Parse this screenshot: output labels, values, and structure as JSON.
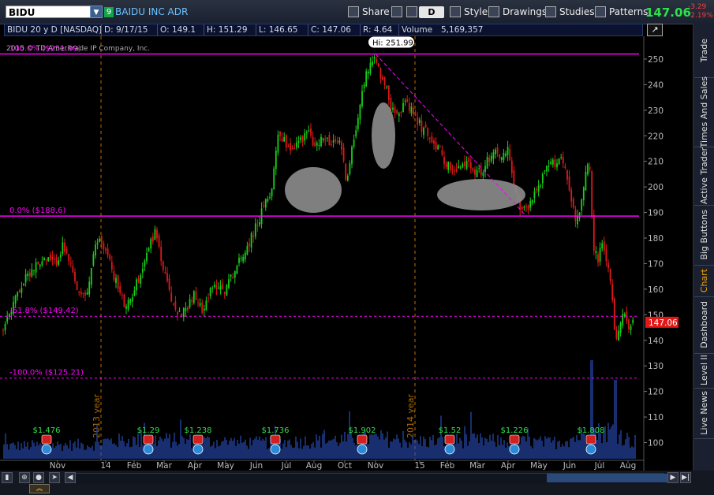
{
  "toolbar": {
    "symbol": "BIDU",
    "link_number": "9",
    "company": "BAIDU INC ADR",
    "share_label": "Share",
    "aggregation": "D",
    "style_label": "Style",
    "drawings_label": "Drawings",
    "studies_label": "Studies",
    "patterns_label": "Patterns",
    "last_price": "147.06",
    "net_change": "-3.29",
    "pct_change": "-2.19%"
  },
  "infobar": {
    "study": "BIDU 20 y D [NASDAQ]",
    "date": "D: 9/17/15",
    "open": "O: 149.1",
    "high": "H: 151.29",
    "low": "L: 146.65",
    "close": "C: 147.06",
    "range": "R: 4.64",
    "volume": "Volume",
    "volume_value": "5,169,357"
  },
  "copyright": "2015 © TD Ameritrade IP Company, Inc.",
  "right_tabs": [
    "Trade",
    "Times And Sales",
    "Active Trader",
    "Big Buttons",
    "Chart",
    "Dashboard",
    "Level II",
    "Live News"
  ],
  "colors": {
    "up": "#19d019",
    "down": "#e01818",
    "fib": "#ff00ff",
    "axis_text": "#bbbbbb",
    "price_badge": "#e01818"
  },
  "chart_data": {
    "type": "candlestick",
    "y_ticks": [
      250,
      240,
      230,
      220,
      210,
      200,
      190,
      180,
      170,
      160,
      150,
      140,
      130,
      120,
      110,
      100
    ],
    "y_range": [
      96,
      257
    ],
    "x_labels": [
      "Nov",
      "14",
      "Feb",
      "Mar",
      "Apr",
      "May",
      "Jun",
      "Jul",
      "Aug",
      "Oct",
      "Nov",
      "15",
      "Feb",
      "Mar",
      "Apr",
      "May",
      "Jun",
      "Jul",
      "Aug"
    ],
    "year_markers": [
      "2013 year",
      "2014 year"
    ],
    "hi_label": "Hi: 251.99",
    "current_price_label": "147.06",
    "fib_levels": [
      {
        "label": "100.0%  ($251.99)",
        "price": 251.99,
        "style": "solid"
      },
      {
        "label": "0.0%  ($188.6)",
        "price": 188.6,
        "style": "solid"
      },
      {
        "label": "-61.8%  ($149.42)",
        "price": 149.42,
        "style": "dashed"
      },
      {
        "label": "-100.0%  ($125.21)",
        "price": 125.21,
        "style": "dashed"
      }
    ],
    "dividends": [
      "$1.476",
      "$1.29",
      "$1.238",
      "$1.736",
      "$1.902",
      "$1.52",
      "$1.226",
      "$1.808"
    ],
    "path": [
      [
        0,
        143
      ],
      [
        10,
        150
      ],
      [
        25,
        160
      ],
      [
        40,
        168
      ],
      [
        55,
        172
      ],
      [
        70,
        170
      ],
      [
        80,
        177
      ],
      [
        90,
        168
      ],
      [
        100,
        157
      ],
      [
        110,
        158
      ],
      [
        120,
        175
      ],
      [
        125,
        180
      ],
      [
        130,
        178
      ],
      [
        140,
        170
      ],
      [
        150,
        160
      ],
      [
        160,
        152
      ],
      [
        170,
        160
      ],
      [
        180,
        168
      ],
      [
        190,
        178
      ],
      [
        198,
        183
      ],
      [
        205,
        170
      ],
      [
        215,
        158
      ],
      [
        225,
        150
      ],
      [
        235,
        152
      ],
      [
        245,
        158
      ],
      [
        255,
        152
      ],
      [
        265,
        158
      ],
      [
        275,
        162
      ],
      [
        285,
        160
      ],
      [
        295,
        166
      ],
      [
        305,
        172
      ],
      [
        315,
        178
      ],
      [
        325,
        185
      ],
      [
        335,
        192
      ],
      [
        345,
        200
      ],
      [
        352,
        222
      ],
      [
        360,
        218
      ],
      [
        370,
        215
      ],
      [
        380,
        218
      ],
      [
        390,
        222
      ],
      [
        400,
        215
      ],
      [
        410,
        220
      ],
      [
        420,
        216
      ],
      [
        430,
        218
      ],
      [
        440,
        202
      ],
      [
        445,
        212
      ],
      [
        450,
        222
      ],
      [
        458,
        236
      ],
      [
        465,
        245
      ],
      [
        472,
        251
      ],
      [
        480,
        246
      ],
      [
        488,
        240
      ],
      [
        495,
        232
      ],
      [
        505,
        230
      ],
      [
        515,
        232
      ],
      [
        525,
        228
      ],
      [
        535,
        223
      ],
      [
        545,
        220
      ],
      [
        555,
        215
      ],
      [
        565,
        210
      ],
      [
        575,
        205
      ],
      [
        585,
        208
      ],
      [
        595,
        210
      ],
      [
        605,
        205
      ],
      [
        615,
        208
      ],
      [
        625,
        215
      ],
      [
        635,
        212
      ],
      [
        645,
        215
      ],
      [
        650,
        200
      ],
      [
        655,
        195
      ],
      [
        662,
        190
      ],
      [
        668,
        192
      ],
      [
        675,
        196
      ],
      [
        685,
        202
      ],
      [
        695,
        208
      ],
      [
        705,
        210
      ],
      [
        712,
        212
      ],
      [
        718,
        205
      ],
      [
        724,
        196
      ],
      [
        730,
        186
      ],
      [
        737,
        194
      ],
      [
        742,
        204
      ],
      [
        747,
        210
      ],
      [
        752,
        176
      ],
      [
        758,
        172
      ],
      [
        764,
        178
      ],
      [
        770,
        170
      ],
      [
        775,
        160
      ],
      [
        780,
        140
      ],
      [
        786,
        148
      ],
      [
        792,
        152
      ],
      [
        798,
        145
      ],
      [
        803,
        147
      ]
    ],
    "volume_baseline": [
      [
        0,
        40
      ],
      [
        120,
        45
      ],
      [
        130,
        55
      ],
      [
        200,
        60
      ],
      [
        330,
        50
      ],
      [
        480,
        65
      ],
      [
        520,
        55
      ],
      [
        600,
        58
      ],
      [
        700,
        50
      ],
      [
        748,
        80
      ],
      [
        778,
        90
      ],
      [
        800,
        55
      ]
    ],
    "ellipses": [
      {
        "cx": 397,
        "cy": 241,
        "rx": 36,
        "ry": 29
      },
      {
        "cx": 486,
        "cy": 172,
        "rx": 15,
        "ry": 42
      },
      {
        "cx": 610,
        "cy": 247,
        "rx": 56,
        "ry": 20
      }
    ]
  }
}
